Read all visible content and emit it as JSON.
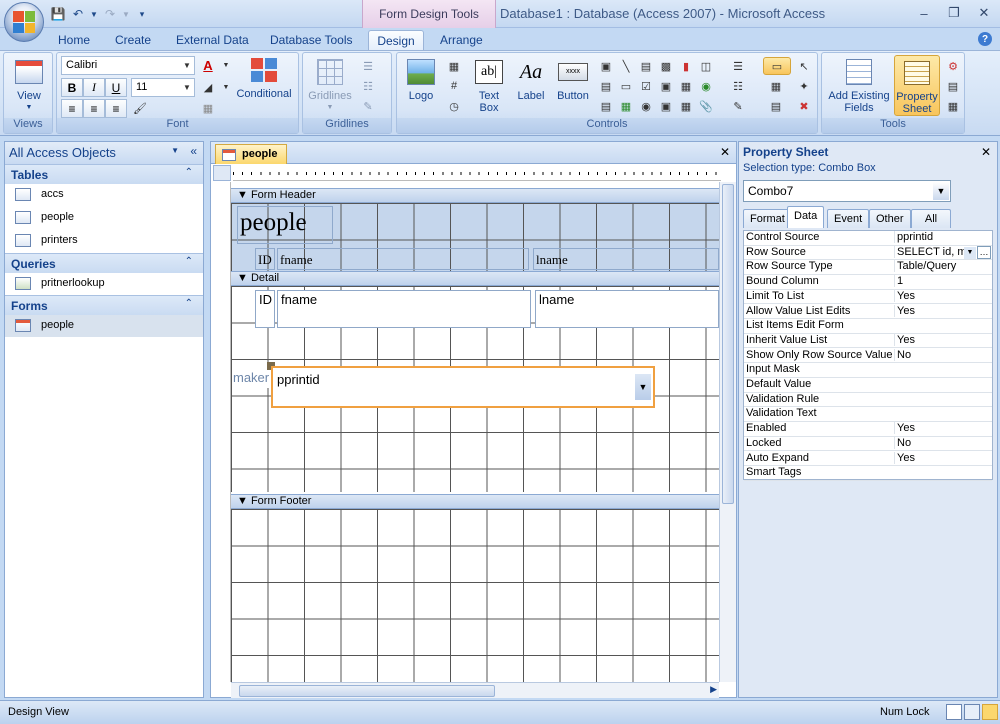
{
  "window": {
    "title": "Database1 : Database (Access 2007) - Microsoft Access",
    "contextual_title": "Form Design Tools"
  },
  "tabs": [
    "Home",
    "Create",
    "External Data",
    "Database Tools",
    "Design",
    "Arrange"
  ],
  "active_tab": "Design",
  "ribbon": {
    "views": {
      "view_label": "View",
      "group": "Views"
    },
    "font": {
      "font_name": "Calibri",
      "font_size": "11",
      "group": "Font",
      "conditional": "Conditional"
    },
    "gridlines": {
      "label": "Gridlines",
      "group": "Gridlines"
    },
    "controls": {
      "logo": "Logo",
      "textbox": "Text Box",
      "label": "Label",
      "button": "Button",
      "group": "Controls"
    },
    "tools": {
      "add_fields": "Add Existing Fields",
      "property_sheet": "Property Sheet",
      "group": "Tools"
    }
  },
  "nav": {
    "header": "All Access Objects",
    "sections": [
      {
        "title": "Tables",
        "items": [
          "accs",
          "people",
          "printers"
        ]
      },
      {
        "title": "Queries",
        "items": [
          "pritnerlookup"
        ]
      },
      {
        "title": "Forms",
        "items": [
          "people"
        ]
      }
    ]
  },
  "document": {
    "tab": "people",
    "sections": {
      "header": "Form Header",
      "detail": "Detail",
      "footer": "Form Footer"
    },
    "header_title": "people",
    "header_labels": [
      "ID",
      "fname",
      "lname"
    ],
    "detail_fields": [
      "ID",
      "fname",
      "lname"
    ],
    "combo_label": "maker",
    "combo_value": "pprintid"
  },
  "property_sheet": {
    "title": "Property Sheet",
    "selection_type": "Selection type:  Combo Box",
    "object": "Combo7",
    "tabs": [
      "Format",
      "Data",
      "Event",
      "Other",
      "All"
    ],
    "active_tab": "Data",
    "rows": [
      {
        "name": "Control Source",
        "value": "pprintid"
      },
      {
        "name": "Row Source",
        "value": "SELECT id, m"
      },
      {
        "name": "Row Source Type",
        "value": "Table/Query"
      },
      {
        "name": "Bound Column",
        "value": "1"
      },
      {
        "name": "Limit To List",
        "value": "Yes"
      },
      {
        "name": "Allow Value List Edits",
        "value": "Yes"
      },
      {
        "name": "List Items Edit Form",
        "value": ""
      },
      {
        "name": "Inherit Value List",
        "value": "Yes"
      },
      {
        "name": "Show Only Row Source Values",
        "value": "No"
      },
      {
        "name": "Input Mask",
        "value": ""
      },
      {
        "name": "Default Value",
        "value": ""
      },
      {
        "name": "Validation Rule",
        "value": ""
      },
      {
        "name": "Validation Text",
        "value": ""
      },
      {
        "name": "Enabled",
        "value": "Yes"
      },
      {
        "name": "Locked",
        "value": "No"
      },
      {
        "name": "Auto Expand",
        "value": "Yes"
      },
      {
        "name": "Smart Tags",
        "value": ""
      }
    ]
  },
  "status": {
    "left": "Design View",
    "right": "Num Lock"
  }
}
